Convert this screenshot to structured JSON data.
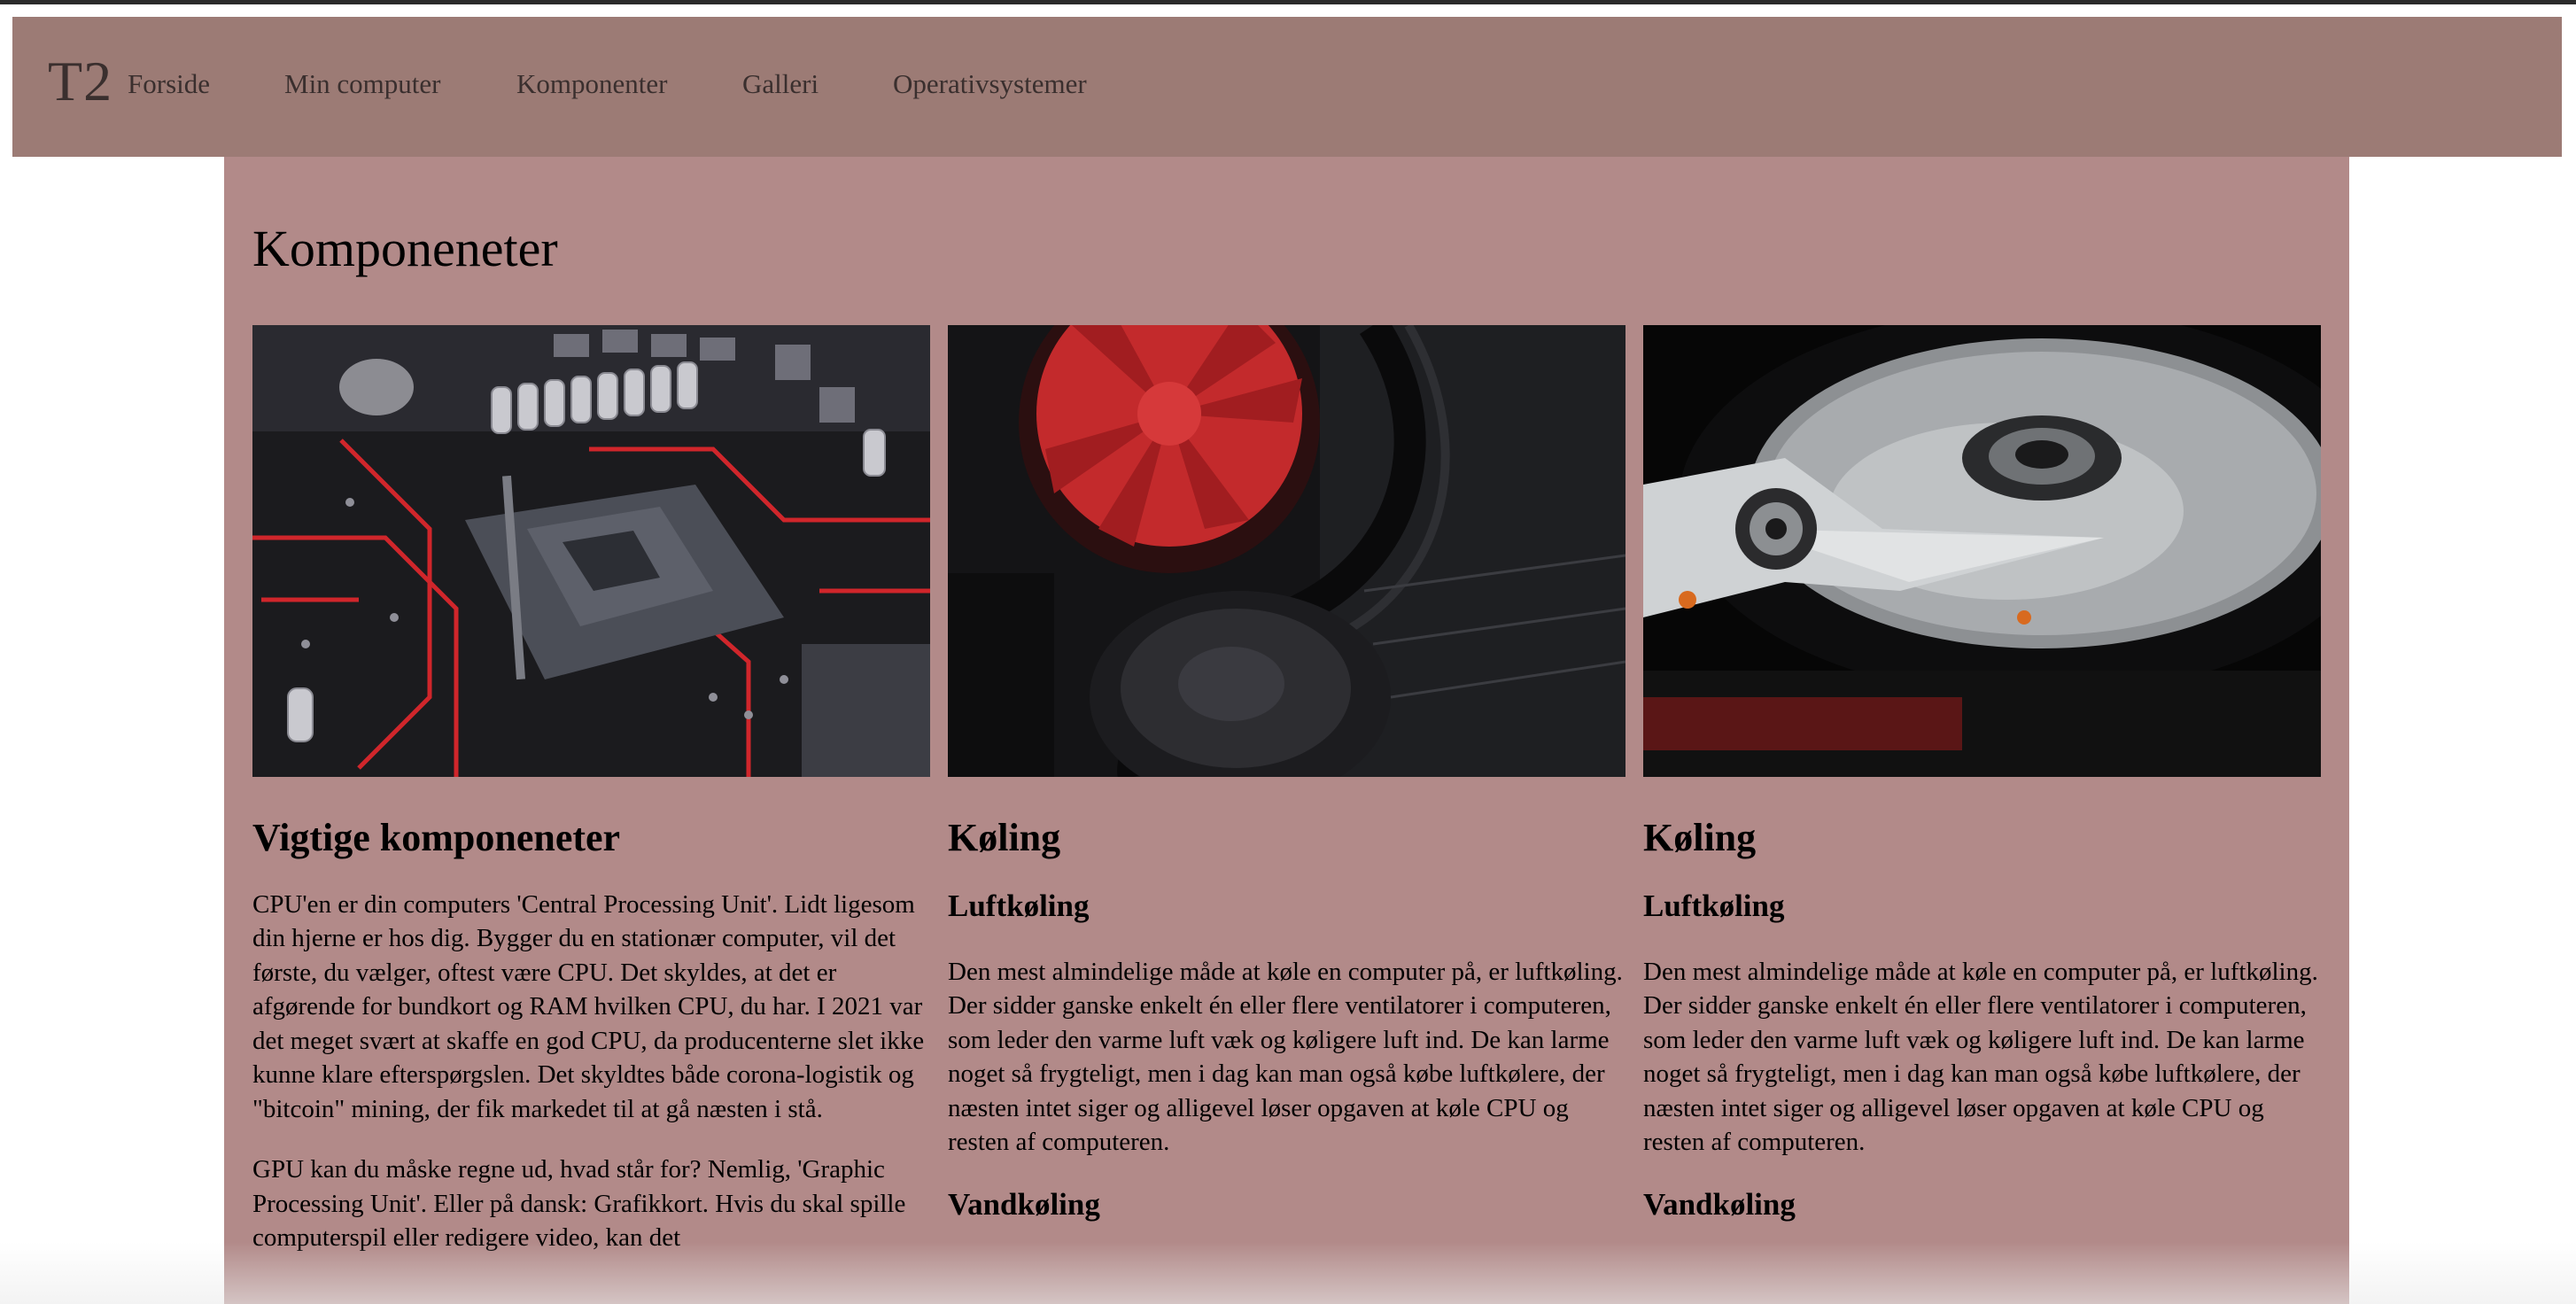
{
  "nav": {
    "brand": "T2",
    "links": [
      "Forside",
      "Min computer",
      "Komponenter",
      "Galleri",
      "Operativsystemer"
    ]
  },
  "page": {
    "title": "Komponeneter"
  },
  "columns": [
    {
      "image_alt": "motherboard-photo",
      "heading": "Vigtige komponeneter",
      "paragraphs": [
        "CPU'en er din computers 'Central Processing Unit'. Lidt ligesom din hjerne er hos dig. Bygger du en stationær computer, vil det første, du vælger, oftest være CPU. Det skyldes, at det er afgørende for bundkort og RAM hvilken CPU, du har. I 2021 var det meget svært at skaffe en god CPU, da producenterne slet ikke kunne klare efterspørgslen. Det skyldtes både corona-logistik og \"bitcoin\" mining, der fik markedet til at gå næsten i stå.",
        "GPU kan du måske regne ud, hvad står for? Nemlig, 'Graphic Processing Unit'. Eller på dansk: Grafikkort. Hvis du skal spille computerspil eller redigere video, kan det"
      ]
    },
    {
      "image_alt": "cooler-photo",
      "heading": "Køling",
      "subheading": "Luftkøling",
      "paragraph": "Den mest almindelige måde at køle en computer på, er luftkøling. Der sidder ganske enkelt én eller flere ventilatorer i computeren, som leder den varme luft væk og køligere luft ind. De kan larme noget så frygteligt, men i dag kan man også købe luftkølere, der næsten intet siger og alligevel løser opgaven at køle CPU og resten af computeren.",
      "subheading2": "Vandkøling"
    },
    {
      "image_alt": "hard-drive-photo",
      "heading": "Køling",
      "subheading": "Luftkøling",
      "paragraph": "Den mest almindelige måde at køle en computer på, er luftkøling. Der sidder ganske enkelt én eller flere ventilatorer i computeren, som leder den varme luft væk og køligere luft ind. De kan larme noget så frygteligt, men i dag kan man også købe luftkølere, der næsten intet siger og alligevel løser opgaven at køle CPU og resten af computeren.",
      "subheading2": "Vandkøling"
    }
  ],
  "colors": {
    "navbar": "#9c7b75",
    "content": "#b28a89",
    "nav_text": "#3a2f2e"
  }
}
